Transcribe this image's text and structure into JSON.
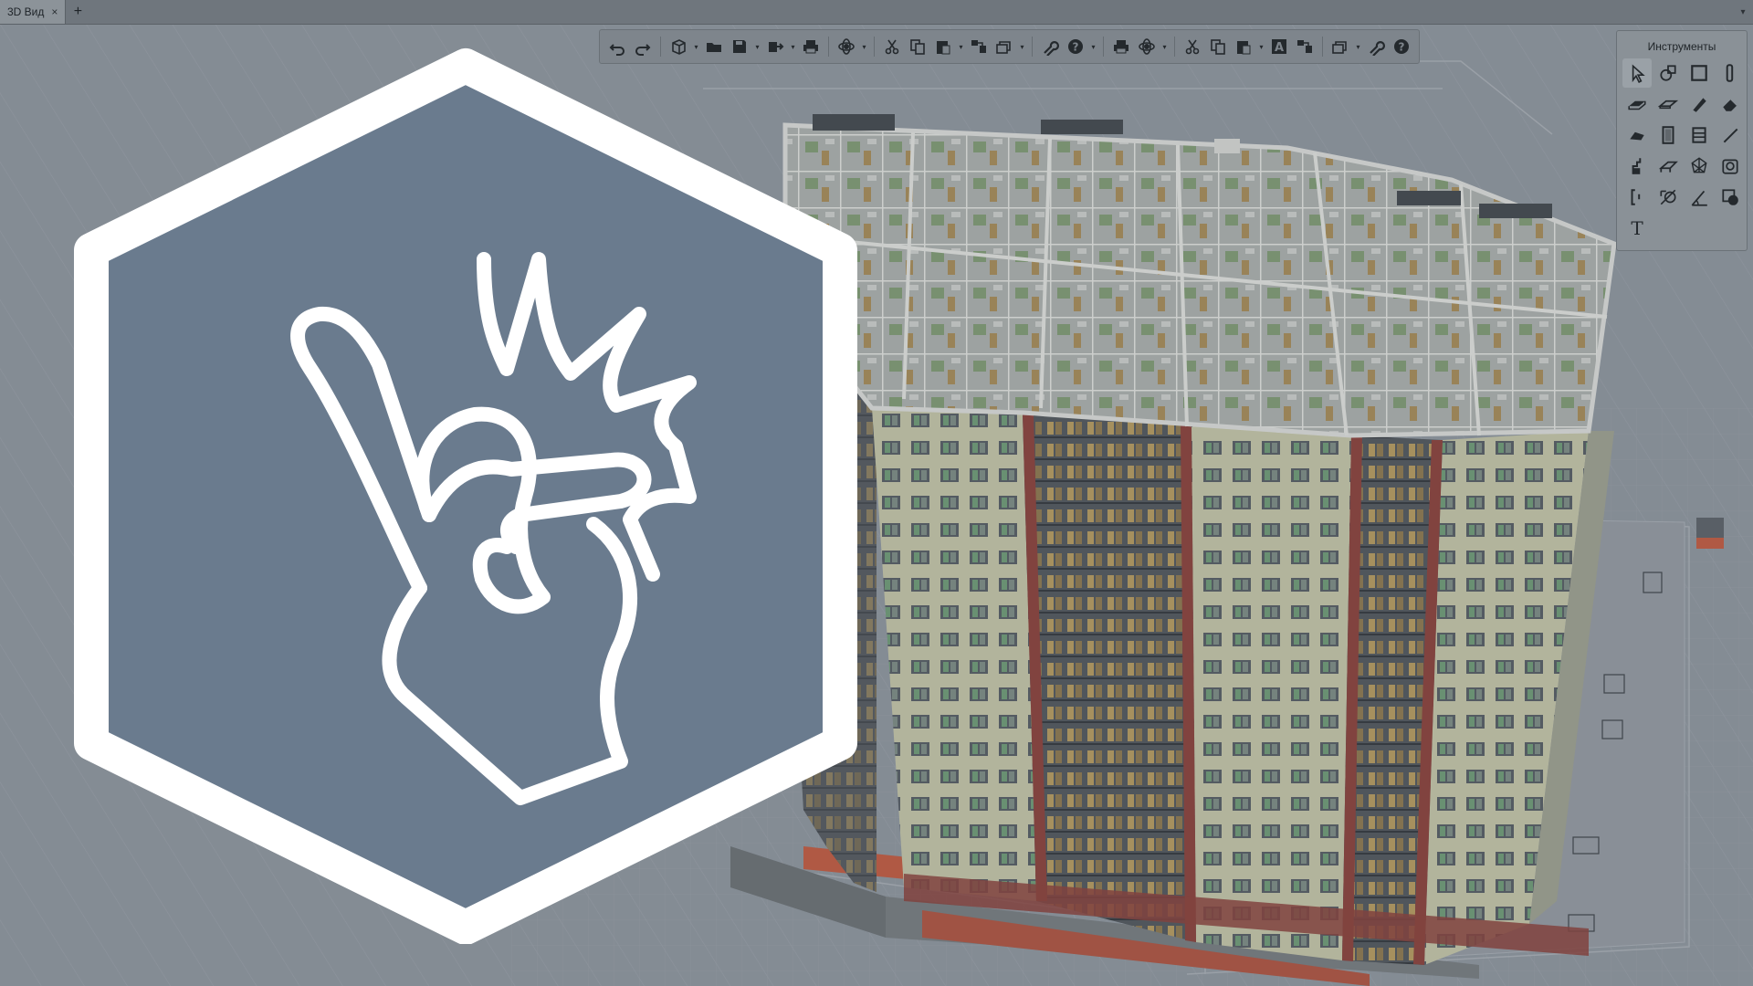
{
  "app": {
    "tabs": [
      {
        "label": "3D Вид",
        "close": "×"
      }
    ],
    "add_tab_label": "+",
    "tabbar_menu": "▾"
  },
  "toolbar": {
    "buttons": [
      "undo-icon",
      "redo-icon",
      "cube-view-icon",
      "open-folder-icon",
      "save-icon",
      "export-icon",
      "print-icon",
      "orbit-icon",
      "cut-icon",
      "copy-icon",
      "paste-icon",
      "layers-icon",
      "stack-icon",
      "wrench-icon",
      "help-icon",
      "print-icon",
      "orbit-icon",
      "cut-icon",
      "copy-icon",
      "paste-icon",
      "text-style-icon",
      "layers-icon",
      "stack-icon",
      "wrench-icon",
      "help-icon"
    ],
    "dropdown_glyph": "▾"
  },
  "tools": {
    "title": "Инструменты",
    "items": [
      "select-arrow-icon",
      "shape-icon",
      "rectangle-icon",
      "column-icon",
      "slab-icon",
      "beam-icon",
      "pencil-icon",
      "eraser-icon",
      "roof-icon",
      "door-icon",
      "window-icon",
      "line-icon",
      "stair-icon",
      "railing-icon",
      "mesh-icon",
      "camera-icon",
      "bracket-icon",
      "dimension-icon",
      "angle-icon",
      "fill-icon",
      "text-icon"
    ],
    "text_tool_label": "T"
  },
  "overlay": {
    "badge": "finger-snap-icon",
    "colors": {
      "hexagon_fill": "#6a7b8e",
      "hexagon_border": "#ffffff",
      "stroke": "#ffffff"
    }
  },
  "scene": {
    "colors": {
      "background": "#8e959c",
      "facade_light": "#c6c6a5",
      "facade_dark": "#585c60",
      "accent_red": "#8a3c34",
      "window_glass": "#6d9a72",
      "window_warm": "#b89a5a",
      "roof_interior": "#b3b5b0"
    }
  }
}
